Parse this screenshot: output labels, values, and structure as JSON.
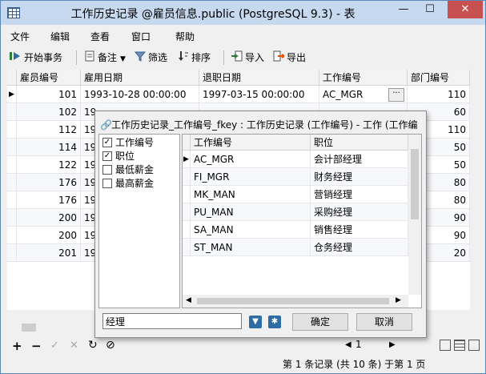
{
  "window": {
    "title": "工作历史记录 @雇员信息.public (PostgreSQL 9.3) - 表",
    "minimize": "—",
    "maximize": "☐",
    "close": "✕"
  },
  "menu": [
    "文件",
    "编辑",
    "查看",
    "窗口",
    "帮助"
  ],
  "toolbar": {
    "begin_transaction": "开始事务",
    "note": "备注",
    "filter": "筛选",
    "sort": "排序",
    "import": "导入",
    "export": "导出"
  },
  "grid": {
    "columns": [
      "雇员编号",
      "雇用日期",
      "退职日期",
      "工作编号",
      "部门编号"
    ],
    "rows": [
      {
        "id": "101",
        "hire": "1993-10-28 00:00:00",
        "leave": "1997-03-15 00:00:00",
        "job": "AC_MGR",
        "dept": "110"
      },
      {
        "id": "102",
        "hire": "19",
        "leave": "",
        "job": "",
        "dept": "60"
      },
      {
        "id": "112",
        "hire": "19",
        "leave": "",
        "job": "",
        "dept": "110"
      },
      {
        "id": "114",
        "hire": "19",
        "leave": "",
        "job": "",
        "dept": "50"
      },
      {
        "id": "122",
        "hire": "19",
        "leave": "",
        "job": "",
        "dept": "50"
      },
      {
        "id": "176",
        "hire": "19",
        "leave": "",
        "job": "",
        "dept": "80"
      },
      {
        "id": "176",
        "hire": "19",
        "leave": "",
        "job": "",
        "dept": "80"
      },
      {
        "id": "200",
        "hire": "19",
        "leave": "",
        "job": "",
        "dept": "90"
      },
      {
        "id": "200",
        "hire": "19",
        "leave": "",
        "job": "",
        "dept": "90"
      },
      {
        "id": "201",
        "hire": "19",
        "leave": "",
        "job": "",
        "dept": "20"
      }
    ],
    "ellipsis": "···"
  },
  "dialog": {
    "title": "工作历史记录_工作编号_fkey : 工作历史记录 (工作编号) - 工作 (工作编",
    "fields": [
      {
        "label": "工作编号",
        "checked": "✓"
      },
      {
        "label": "职位",
        "checked": "✓"
      },
      {
        "label": "最低薪金",
        "checked": ""
      },
      {
        "label": "最高薪金",
        "checked": ""
      }
    ],
    "columns": [
      "工作编号",
      "职位"
    ],
    "rows": [
      {
        "job": "AC_MGR",
        "title": "会计部经理"
      },
      {
        "job": "FI_MGR",
        "title": "财务经理"
      },
      {
        "job": "MK_MAN",
        "title": "营销经理"
      },
      {
        "job": "PU_MAN",
        "title": "采购经理"
      },
      {
        "job": "SA_MAN",
        "title": "销售经理"
      },
      {
        "job": "ST_MAN",
        "title": "仓务经理"
      }
    ],
    "search_value": "经理",
    "ok": "确定",
    "cancel": "取消"
  },
  "nav": {
    "add": "+",
    "delete": "−",
    "apply": "✓",
    "discard": "✕",
    "refresh": "↻",
    "stop": "⊘",
    "page_number": "1"
  },
  "status": {
    "record_info": "第 1 条记录 (共 10 条) 于第 1 页"
  },
  "colors": {
    "title_bg": "#c6d9ef",
    "close_bg": "#c75050",
    "accent": "#2e6da4"
  }
}
